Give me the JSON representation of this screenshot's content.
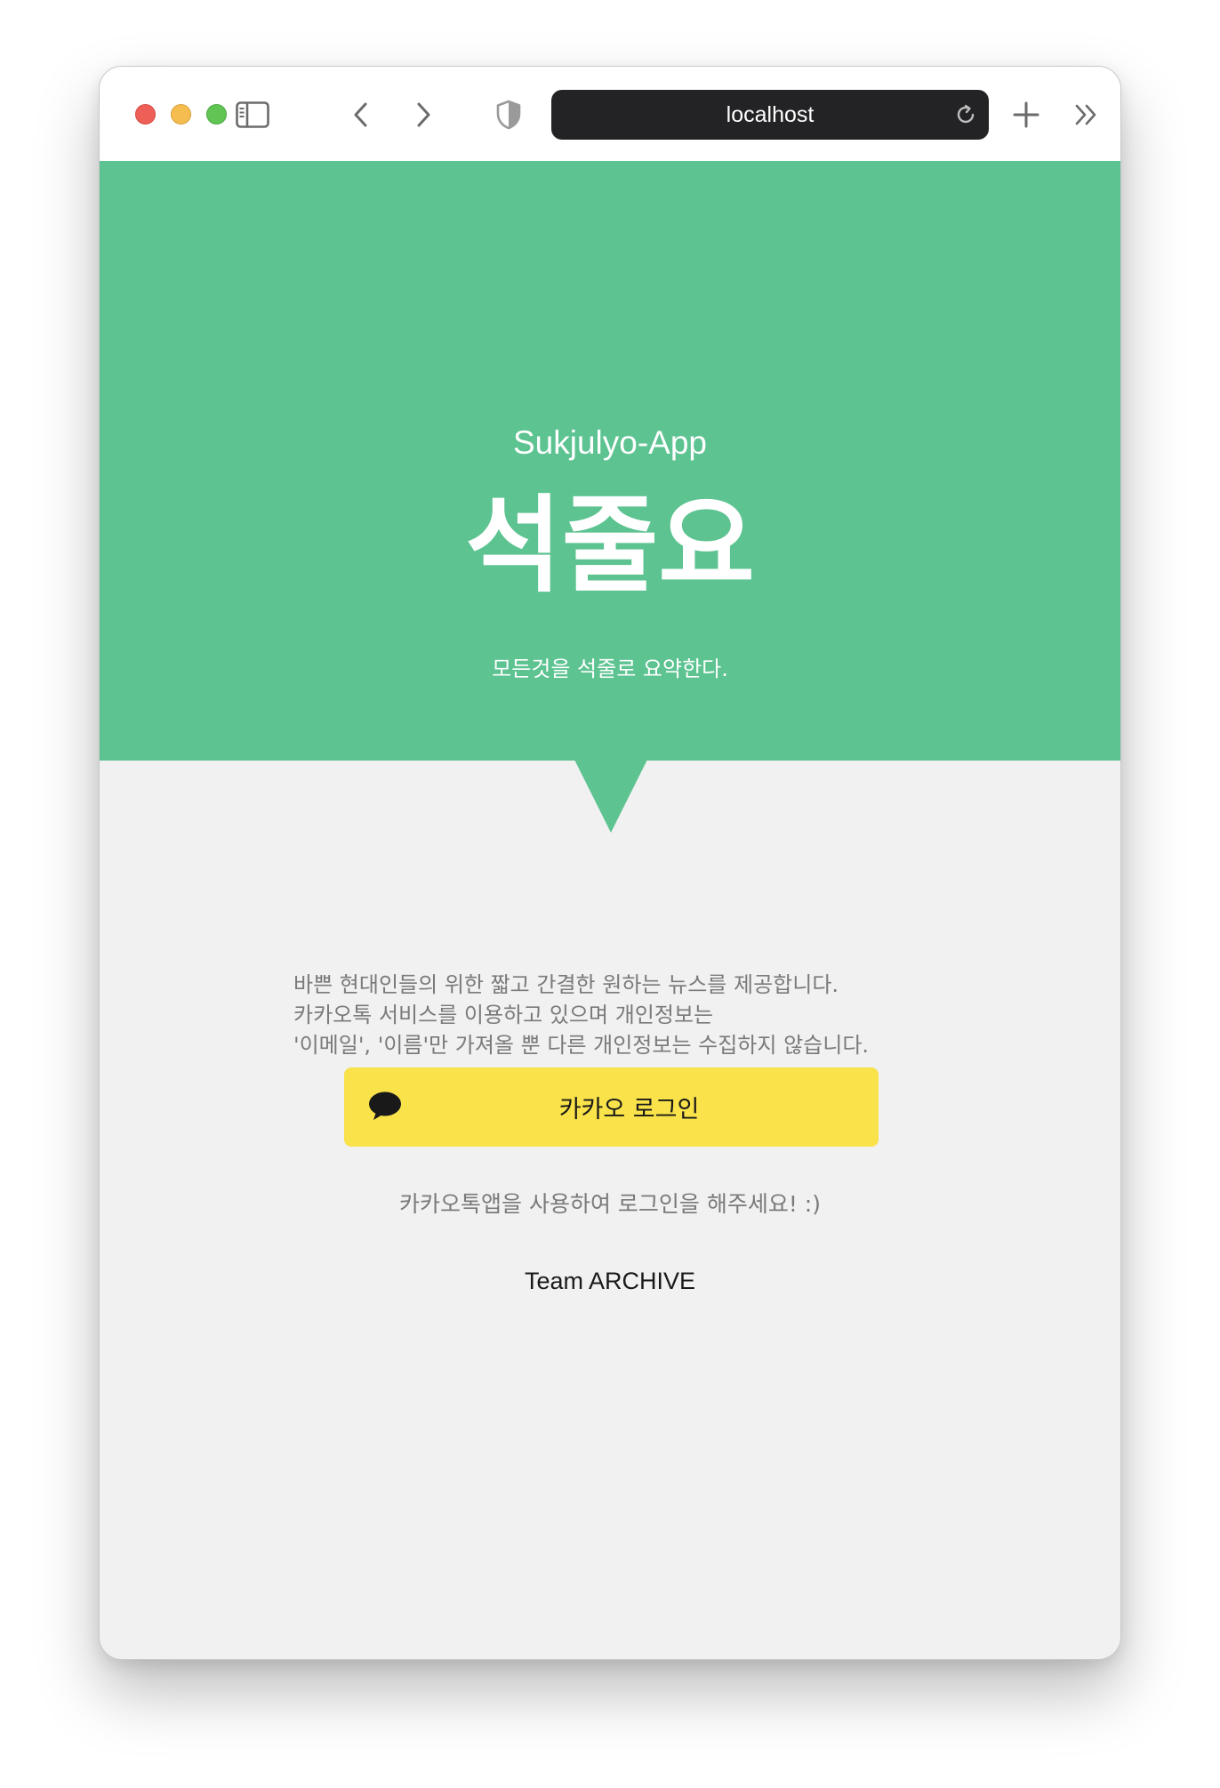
{
  "browser": {
    "url": "localhost",
    "icons": {
      "sidebar": "sidebar-icon",
      "back": "chevron-left-icon",
      "forward": "chevron-right-icon",
      "privacy": "shield-icon",
      "reload": "reload-icon",
      "new_tab": "plus-icon",
      "more": "double-chevron-right-icon"
    }
  },
  "hero": {
    "app_name": "Sukjulyo-App",
    "title": "석줄요",
    "tagline": "모든것을 석줄로 요약한다.",
    "background_color": "#5cc391"
  },
  "content": {
    "description_lines": [
      "바쁜 현대인들의 위한 짧고 간결한 원하는 뉴스를 제공합니다.",
      "카카오톡 서비스를 이용하고 있으며 개인정보는",
      "'이메일', '이름'만 가져올 뿐 다른 개인정보는 수집하지 않습니다."
    ],
    "login_button": {
      "label": "카카오 로그인",
      "icon": "speech-bubble-icon",
      "color": "#f9e24a"
    },
    "hint": "카카오톡앱을 사용하여 로그인을 해주세요! :)",
    "team": "Team ARCHIVE"
  }
}
